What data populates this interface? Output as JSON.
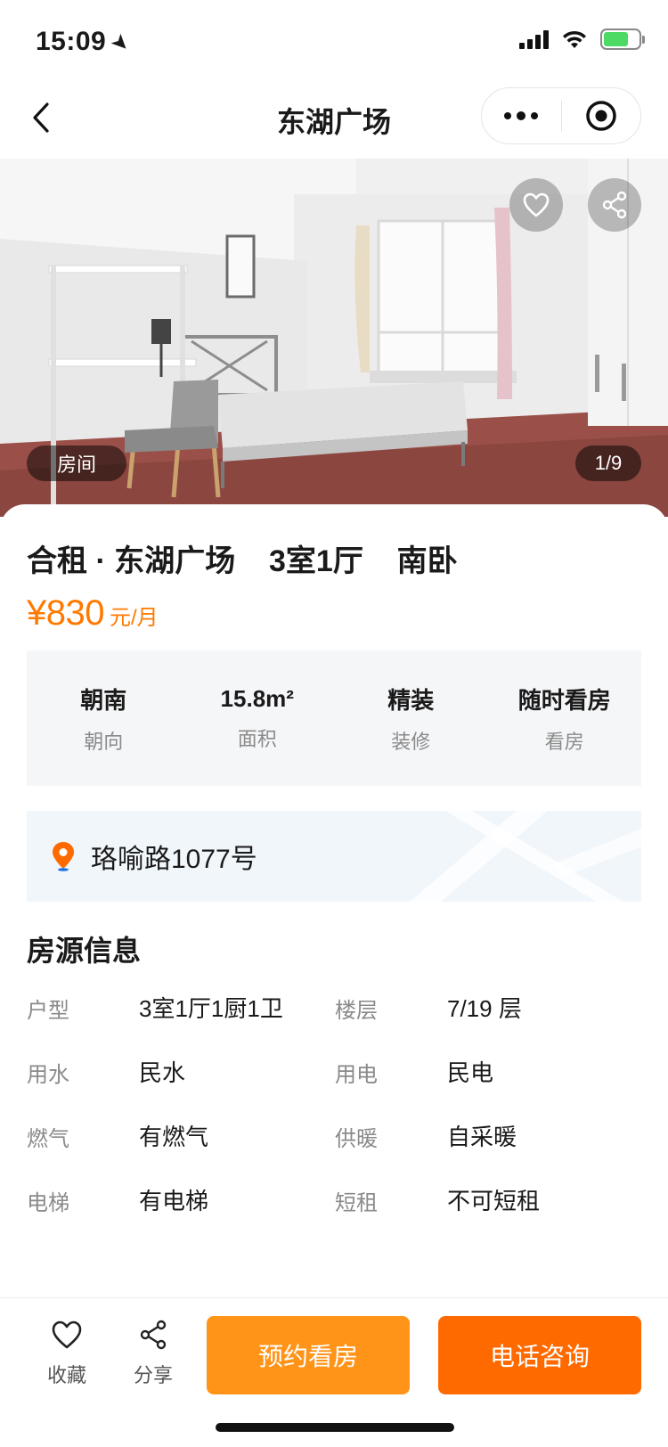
{
  "status_bar": {
    "time": "15:09"
  },
  "nav": {
    "title": "东湖广场"
  },
  "hero": {
    "tag": "房间",
    "counter": "1/9"
  },
  "listing": {
    "title": "合租 · 东湖广场    3室1厅    南卧",
    "price": "¥830",
    "price_unit": "元/月"
  },
  "facts": [
    {
      "value": "朝南",
      "label": "朝向"
    },
    {
      "value": "15.8m²",
      "label": "面积"
    },
    {
      "value": "精装",
      "label": "装修"
    },
    {
      "value": "随时看房",
      "label": "看房"
    }
  ],
  "address": {
    "text": "珞喻路1077号"
  },
  "house_info": {
    "title": "房源信息",
    "rows": [
      [
        {
          "label": "户型",
          "value": "3室1厅1厨1卫"
        },
        {
          "label": "楼层",
          "value": "7/19 层"
        }
      ],
      [
        {
          "label": "用水",
          "value": "民水"
        },
        {
          "label": "用电",
          "value": "民电"
        }
      ],
      [
        {
          "label": "燃气",
          "value": "有燃气"
        },
        {
          "label": "供暖",
          "value": "自采暖"
        }
      ],
      [
        {
          "label": "电梯",
          "value": "有电梯"
        },
        {
          "label": "短租",
          "value": "不可短租"
        }
      ]
    ]
  },
  "bottom_bar": {
    "favorite_label": "收藏",
    "share_label": "分享",
    "book_label": "预约看房",
    "call_label": "电话咨询"
  },
  "colors": {
    "accent_orange": "#ff7a00",
    "book_button": "#ff9419",
    "call_button": "#ff6a00",
    "location_pin": "#ff6a00"
  }
}
